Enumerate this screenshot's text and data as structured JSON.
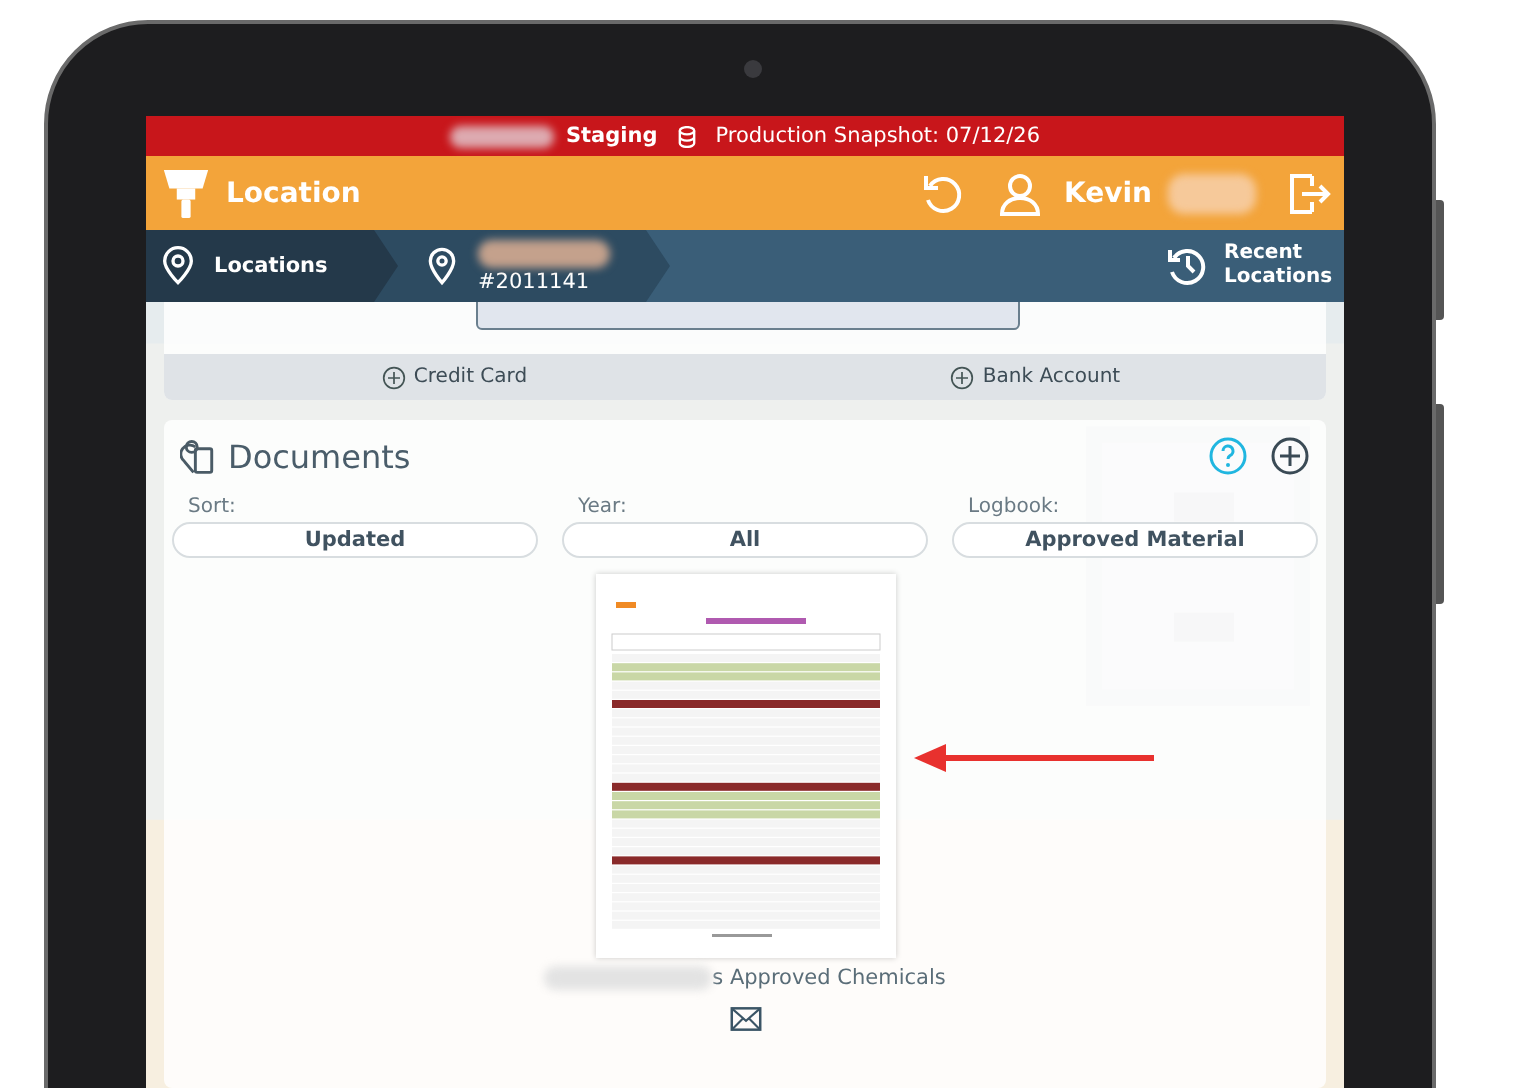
{
  "status_banner": {
    "environment": "Staging",
    "snapshot": "Production Snapshot: 07/12/26"
  },
  "header": {
    "title": "Location",
    "user": "Kevin"
  },
  "breadcrumbs": [
    {
      "label": "Locations"
    },
    {
      "label": "#2011141"
    }
  ],
  "recent": {
    "label": "Recent Locations"
  },
  "payment_actions": [
    "Credit Card",
    "Bank Account"
  ],
  "documents": {
    "title": "Documents",
    "filters": [
      {
        "label": "Sort:",
        "value": "Updated"
      },
      {
        "label": "Year:",
        "value": "All"
      },
      {
        "label": "Logbook:",
        "value": "Approved Material"
      }
    ],
    "items": [
      {
        "name": "s Approved Chemicals"
      }
    ]
  }
}
